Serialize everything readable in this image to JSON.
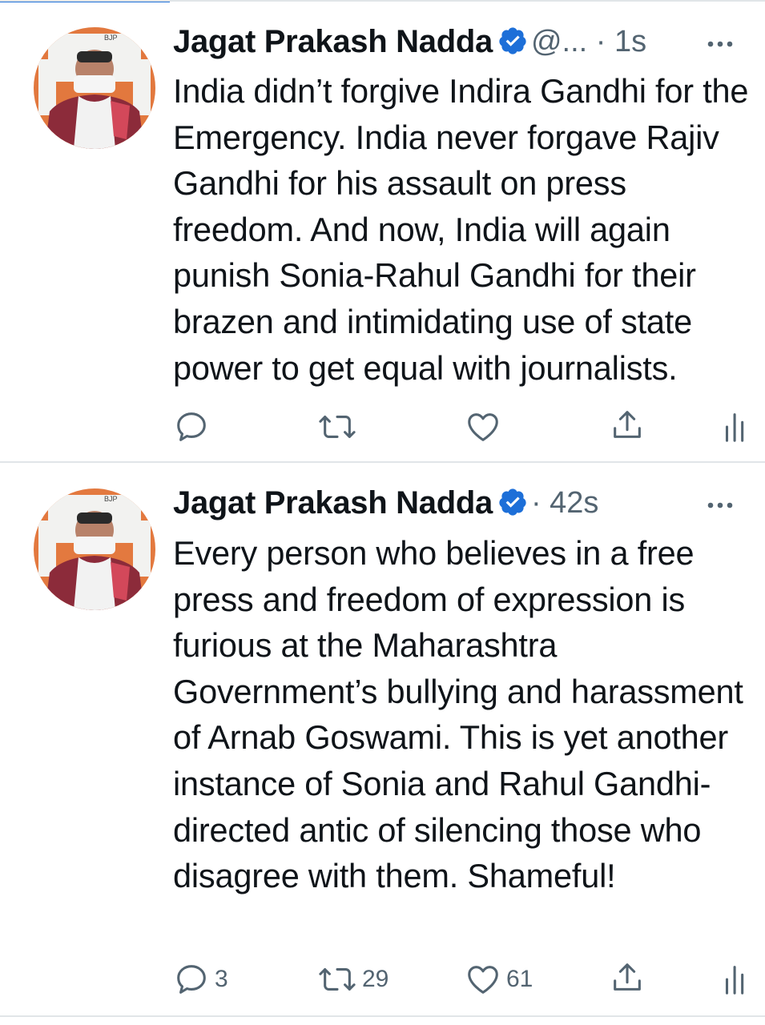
{
  "tweets": [
    {
      "author_name": "Jagat Prakash Nadda",
      "handle": "@...",
      "time": "1s",
      "text": "India didn’t forgive Indira Gandhi for the Emergency. India never forgave Rajiv Gandhi for his assault on press freedom. And now, India will again punish Sonia-Rahul Gandhi for their brazen and intimidating use of state power to get equal with journalists.",
      "replies": "",
      "retweets": "",
      "likes": ""
    },
    {
      "author_name": "Jagat Prakash Nadda",
      "handle": "",
      "time": "42s",
      "text": "Every person who believes in a free press and freedom of expression is furious at the Maharashtra Government’s bullying and harassment of Arnab Goswami. This is yet another instance of Sonia and Rahul Gandhi-directed antic of silencing those who disagree with them. Shameful!",
      "replies": "3",
      "retweets": "29",
      "likes": "61"
    }
  ],
  "avatar_text": "BJP",
  "colors": {
    "verified": "#1d6fd8",
    "accent": "#1d6fd8",
    "icon_gray": "#536471"
  },
  "icons": [
    "verified-badge-icon",
    "more-icon",
    "reply-icon",
    "retweet-icon",
    "like-icon",
    "share-icon",
    "analytics-icon"
  ]
}
